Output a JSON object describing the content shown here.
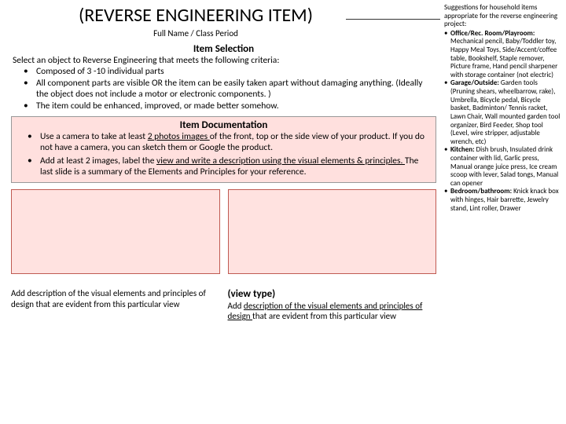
{
  "header": {
    "title": "(REVERSE ENGINEERING ITEM)",
    "subtitle": "Full Name / Class Period"
  },
  "selection": {
    "header": "Item Selection",
    "intro": "Select an object to Reverse Engineering that meets the following criteria:",
    "b1": "Composed of 3 -10 individual parts",
    "b2": "All component parts are visible OR the item can be easily taken apart without damaging anything. (Ideally the object does not include a motor or electronic components. )",
    "b3": "The item could be enhanced, improved, or made better somehow."
  },
  "documentation": {
    "header": "Item Documentation",
    "b1a": "Use a camera to take at least ",
    "b1u": "2 photos images ",
    "b1b": "of the front, top or the side view of your product. If you do not have a camera, you can sketch them or Google the product.",
    "b2a": "Add at least 2 images, label the ",
    "b2u": "view and write a description using the visual elements & principles. ",
    "b2b": "The last slide is a summary of the Elements and Principles for your reference."
  },
  "caption1": {
    "text": "Add description of the visual elements and principles of design that are evident from this particular view"
  },
  "caption2": {
    "vt": "(view type)",
    "a": "Add ",
    "u": "description of the visual elements and principles of design ",
    "b": "that are evident from this particular view"
  },
  "suggestions": {
    "intro": "Suggestions for household items appropriate for the reverse engineering project:",
    "c1h": "Office/Rec. Room/Playroom:",
    "c1t": " Mechanical pencil, Baby/Toddler toy, Happy Meal Toys, Side/Accent/coffee table, Bookshelf, Staple remover, Picture frame, Hand pencil sharpener with storage container (not electric)",
    "c2h": "Garage/Outside:",
    "c2t": " Garden tools (Pruning shears, wheelbarrow, rake), Umbrella, Bicycle pedal, Bicycle basket, Badminton/ Tennis racket, Lawn Chair, Wall mounted garden tool organizer, Bird Feeder, Shop tool (Level, wire stripper, adjustable wrench, etc)",
    "c3h": "Kitchen:",
    "c3t": " Dish brush, Insulated drink container with lid, Garlic press, Manual orange juice press, Ice cream scoop with lever, Salad tongs, Manual can opener",
    "c4h": "Bedroom/bathroom:",
    "c4t": " Knick knack box with hinges, Hair barrette, Jewelry stand, Lint roller, Drawer"
  }
}
